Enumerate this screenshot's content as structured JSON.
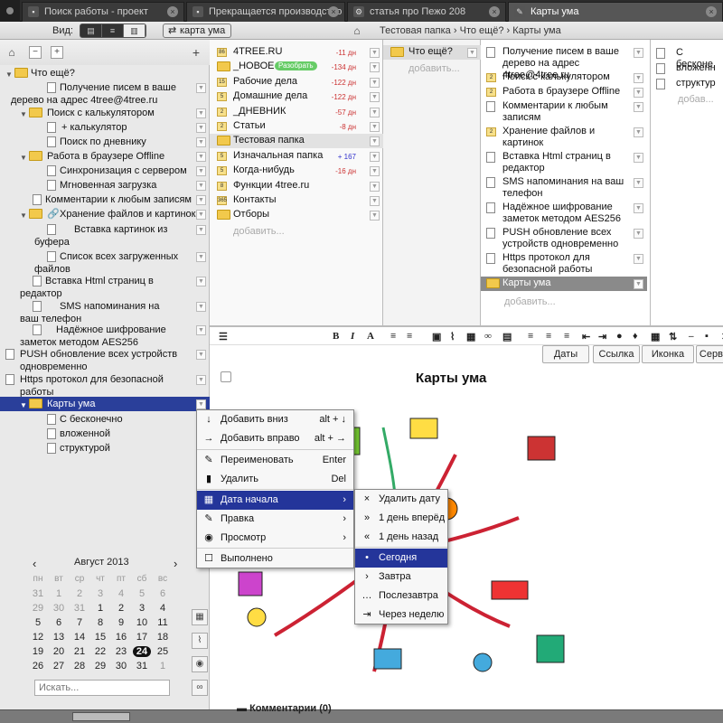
{
  "tabs": [
    {
      "label": "Поиск работы - проект"
    },
    {
      "label": "Прекращается производство Fo..."
    },
    {
      "label": "статья про Пежо 208"
    },
    {
      "label": "Карты ума"
    }
  ],
  "toolbar": {
    "view_label": "Вид:",
    "mindmap_pill": "карта ума",
    "breadcrumb": [
      "Тестовая папка",
      "Что ещё?",
      "Карты ума"
    ]
  },
  "tree": {
    "root": "Что ещё?",
    "items": [
      "Получение писем в ваше дерево на адрес 4tree@4tree.ru",
      "Поиск с калькулятором",
      "+ калькулятор",
      "Поиск по дневнику",
      "Работа в браузере Offline",
      "Синхронизация с сервером",
      "Мгновенная загрузка",
      "Комментарии к любым записям",
      "Хранение файлов и картинок",
      "Вставка картинок из буфера",
      "Список всех загруженных файлов",
      "Вставка Html страниц в редактор",
      "SMS напоминания на ваш телефон",
      "Надёжное шифрование заметок методом AES256",
      "PUSH обновление всех устройств одновременно",
      "Https протокол для безопасной работы",
      "Карты ума",
      "С бесконечно",
      "вложенной",
      "структурой"
    ]
  },
  "calendar": {
    "month": "Август 2013",
    "weekdays": [
      "пн",
      "вт",
      "ср",
      "чт",
      "пт",
      "сб",
      "вс"
    ],
    "weeks": [
      [
        "31",
        "1",
        "2",
        "3",
        "4",
        "5",
        "6"
      ],
      [
        "29",
        "30",
        "31",
        "1",
        "2",
        "3",
        "4"
      ],
      [
        "5",
        "6",
        "7",
        "8",
        "9",
        "10",
        "11"
      ],
      [
        "12",
        "13",
        "14",
        "15",
        "16",
        "17",
        "18"
      ],
      [
        "19",
        "20",
        "21",
        "22",
        "23",
        "24",
        "25"
      ],
      [
        "26",
        "27",
        "28",
        "29",
        "30",
        "31",
        "1"
      ]
    ],
    "today": "24"
  },
  "search_placeholder": "Искать...",
  "col1": [
    {
      "label": "4TREE.RU",
      "badge": "86",
      "num": "-11 дн"
    },
    {
      "label": "_НОВОЕ",
      "badge": "",
      "num": "-134 дн",
      "tag": "Разобрать"
    },
    {
      "label": "Рабочие дела",
      "badge": "15",
      "num": "-122 дн"
    },
    {
      "label": "Домашние дела",
      "badge": "5",
      "num": "-122 дн"
    },
    {
      "label": "_ДНЕВНИК",
      "badge": "2",
      "num": "-57 дн"
    },
    {
      "label": "Статьи",
      "badge": "2",
      "num": "-8 дн"
    },
    {
      "label": "Тестовая папка",
      "badge": "",
      "num": ""
    },
    {
      "label": "Изначальная папка",
      "badge": "5",
      "num": "+ 167"
    },
    {
      "label": "Когда-нибудь",
      "badge": "5",
      "num": "-16 дн"
    },
    {
      "label": "Функции 4tree.ru",
      "badge": "8",
      "num": ""
    },
    {
      "label": "Контакты",
      "badge": "365",
      "num": ""
    },
    {
      "label": "Отборы",
      "badge": "",
      "num": ""
    }
  ],
  "col1_add": "добавить...",
  "col2": [
    "Что ещё?"
  ],
  "col2_add": "добавить...",
  "col3": [
    "Получение писем в ваше дерево на адрес 4tree@4tree.ru",
    "Поиск с калькулятором",
    "Работа в браузере Offline",
    "Комментарии к любым записям",
    "Хранение файлов и картинок",
    "Вставка Html страниц в редактор",
    "SMS напоминания на ваш телефон",
    "Надёжное шифрование заметок методом AES256",
    "PUSH обновление всех устройств одновременно",
    "Https протокол для безопасной работы",
    "Карты ума"
  ],
  "col3_add": "добавить...",
  "col4": [
    "С бесконе",
    "вложенн",
    "структур"
  ],
  "col4_add": "добав...",
  "editor": {
    "format_buttons": [
      "Даты",
      "Ссылка",
      "Иконка",
      "Серви"
    ],
    "title": "Карты ума",
    "comments": "Комментарии (0)"
  },
  "context_menu": [
    {
      "label": "Добавить вниз",
      "shortcut": "alt + ↓",
      "icon": "arrow-down"
    },
    {
      "label": "Добавить вправо",
      "shortcut": "alt + →",
      "icon": "arrow-right"
    },
    {
      "label": "Переименовать",
      "shortcut": "Enter",
      "icon": "pencil"
    },
    {
      "label": "Удалить",
      "shortcut": "Del",
      "icon": "trash"
    },
    {
      "label": "Дата начала",
      "shortcut": "›",
      "icon": "calendar"
    },
    {
      "label": "Правка",
      "shortcut": "›",
      "icon": "edit"
    },
    {
      "label": "Просмотр",
      "shortcut": "›",
      "icon": "eye"
    },
    {
      "label": "Выполнено",
      "shortcut": "",
      "icon": "checkbox"
    }
  ],
  "submenu": [
    {
      "label": "Удалить дату",
      "icon": "×"
    },
    {
      "label": "1 день вперёд",
      "icon": "»"
    },
    {
      "label": "1 день назад",
      "icon": "«"
    },
    {
      "label": "Сегодня",
      "icon": "•"
    },
    {
      "label": "Завтра",
      "icon": "›"
    },
    {
      "label": "Послезавтра",
      "icon": "…"
    },
    {
      "label": "Через неделю",
      "icon": "⇥"
    }
  ]
}
